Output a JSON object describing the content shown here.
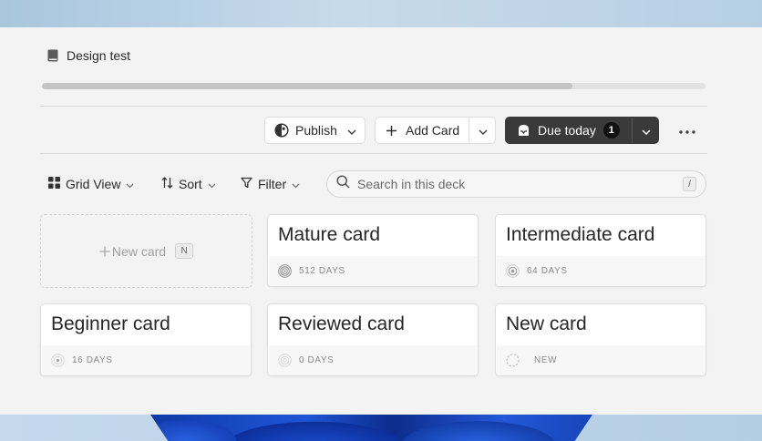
{
  "deck": {
    "title": "Design test",
    "progress_percent": 80
  },
  "toolbar": {
    "publish_label": "Publish",
    "add_card_label": "Add Card",
    "due_today_label": "Due today",
    "due_today_count": "1"
  },
  "viewbar": {
    "grid_view_label": "Grid View",
    "sort_label": "Sort",
    "filter_label": "Filter",
    "search_placeholder": "Search in this deck",
    "search_shortcut": "/"
  },
  "new_card": {
    "label": "New card",
    "shortcut": "N"
  },
  "cards": [
    {
      "title": "Mature card",
      "meta": "512 DAYS",
      "icon": "rings-mature-icon"
    },
    {
      "title": "Intermediate card",
      "meta": "64 DAYS",
      "icon": "rings-intermediate-icon"
    },
    {
      "title": "Beginner card",
      "meta": "16 DAYS",
      "icon": "rings-beginner-icon"
    },
    {
      "title": "Reviewed card",
      "meta": "0 DAYS",
      "icon": "rings-reviewed-icon"
    },
    {
      "title": "New card",
      "meta": "NEW",
      "icon": "dashed-circle-icon"
    }
  ],
  "colors": {
    "accent_dark": "#3a3a3a",
    "background": "#f3f3f3"
  }
}
